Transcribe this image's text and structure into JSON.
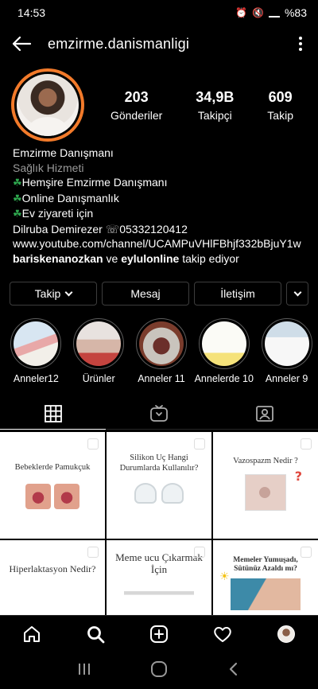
{
  "status_bar": {
    "time": "14:53",
    "battery": "%83"
  },
  "header": {
    "username": "emzirme.danismanligi"
  },
  "profile": {
    "stats": [
      {
        "value": "203",
        "label": "Gönderiler"
      },
      {
        "value": "34,9B",
        "label": "Takipçi"
      },
      {
        "value": "609",
        "label": "Takip"
      }
    ],
    "name": "Emzirme Danışmanı",
    "category": "Sağlık Hizmeti",
    "bio_lines": [
      "Hemşire Emzirme Danışmanı",
      "Online Danışmanlık",
      "Ev ziyareti için"
    ],
    "contact_name": "Dilruba Demirezer",
    "phone": "05332120412",
    "website": "www.youtube.com/channel/UCAMPuVHlFBhjf332bBjuY1w",
    "followed_by": {
      "user1": "bariskenanozkan",
      "connector": " ve ",
      "user2": "eylulonline",
      "suffix": " takip ediyor"
    }
  },
  "actions": {
    "follow": "Takip",
    "message": "Mesaj",
    "contact": "İletişim"
  },
  "highlights": [
    {
      "label": "Anneler12"
    },
    {
      "label": "Ürünler"
    },
    {
      "label": "Anneler 11"
    },
    {
      "label": "Annelerde 10"
    },
    {
      "label": "Anneler 9"
    }
  ],
  "posts": [
    {
      "title": "Bebeklerde Pamukçuk"
    },
    {
      "title": "Silikon Uç Hangi Durumlarda Kullanılır?"
    },
    {
      "title": "Vazospazm Nedir ?"
    },
    {
      "title": "Hiperlaktasyon Nedir?"
    },
    {
      "title": "Meme ucu Çıkarmak İçin"
    },
    {
      "title": "Memeler Yumuşadı, Sütünüz Azaldı mı?"
    }
  ]
}
